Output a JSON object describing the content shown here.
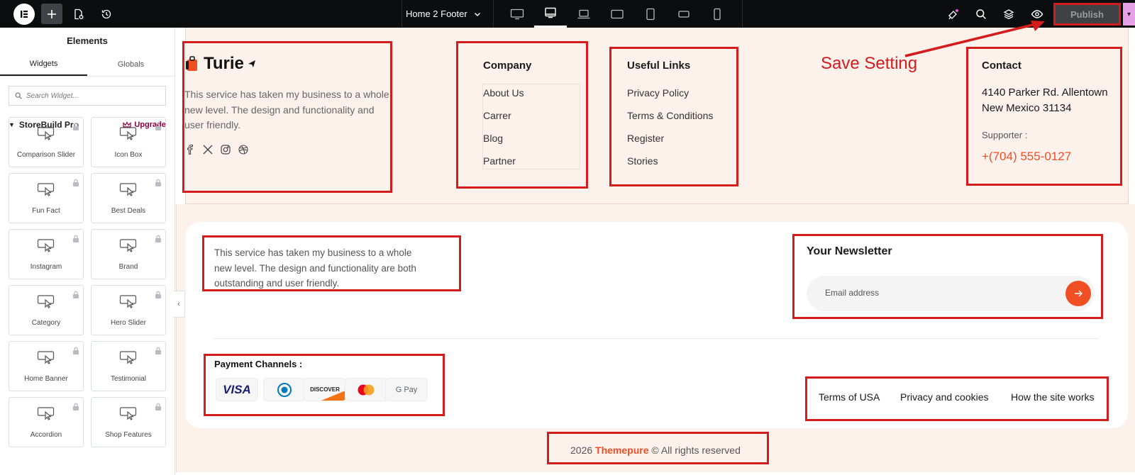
{
  "topbar": {
    "document_title": "Home 2 Footer",
    "publish_label": "Publish"
  },
  "sidebar": {
    "title": "Elements",
    "tabs": [
      "Widgets",
      "Globals"
    ],
    "search_placeholder": "Search Widget...",
    "category": "StoreBuild Pro",
    "upgrade_label": "Upgrade",
    "widgets": [
      "Comparison Slider",
      "Icon Box",
      "Fun Fact",
      "Best Deals",
      "Instagram",
      "Brand",
      "Category",
      "Hero Slider",
      "Home Banner",
      "Testimonial",
      "Accordion",
      "Shop Features"
    ]
  },
  "annotation": {
    "save_setting": "Save Setting"
  },
  "footer": {
    "brand": "Turie",
    "brand_desc": "This service has taken my business to a whole new level. The design and functionality and user friendly.",
    "company": {
      "title": "Company",
      "links": [
        "About Us",
        "Carrer",
        "Blog",
        "Partner"
      ]
    },
    "useful": {
      "title": "Useful Links",
      "links": [
        "Privacy Policy",
        "Terms & Conditions",
        "Register",
        "Stories"
      ]
    },
    "contact": {
      "title": "Contact",
      "address_1": "4140 Parker Rd. Allentown",
      "address_2": "New Mexico 31134",
      "supporter_label": "Supporter :",
      "phone": "+(704) 555-0127"
    },
    "bottom_desc": "This service has taken my business to a whole new level. The design and functionality are both outstanding and user friendly.",
    "newsletter": {
      "title": "Your Newsletter",
      "placeholder": "Email address"
    },
    "payment": {
      "title": "Payment Channels :",
      "cards": [
        "VISA",
        "Diners Club",
        "DISCOVER",
        "Mastercard",
        "G Pay"
      ]
    },
    "legal_links": [
      "Terms of USA",
      "Privacy and cookies",
      "How the site works"
    ],
    "copyright": {
      "year": "2026",
      "brand": "Themepure",
      "suffix": "© All rights reserved"
    }
  },
  "colors": {
    "accent": "#f04e23",
    "annotation_red": "#d41c1c",
    "footer_bg": "#fdf1ec"
  }
}
